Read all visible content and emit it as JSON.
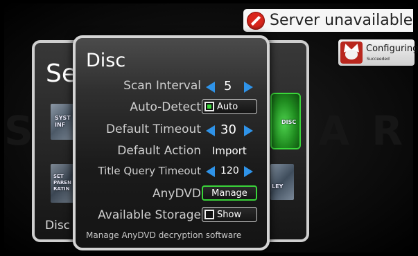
{
  "server_banner": {
    "text": "Server unavailable",
    "icon": "no-entry-icon",
    "color": "#d9261c"
  },
  "config_toast": {
    "title": "Configuring",
    "subtitle": "Succeeded",
    "icon": "fox-logo-icon"
  },
  "background": {
    "watermark": "S T E M   S E A R C H"
  },
  "left_card": {
    "title": "Se",
    "tiles": [
      {
        "text": "SYST INF"
      },
      {
        "text": "SET PAREN RATIN"
      }
    ],
    "footer": "Disc"
  },
  "right_card": {
    "tiles": [
      {
        "text": "DISC",
        "selected": true
      },
      {
        "text": "LEY"
      }
    ]
  },
  "panel": {
    "title": "Disc",
    "settings": [
      {
        "label": "Scan Interval",
        "value": "5",
        "control": "stepper"
      },
      {
        "label": "Auto-Detect",
        "value": "Auto",
        "control": "checkbox",
        "checked": true
      },
      {
        "label": "Default Timeout",
        "value": "30",
        "control": "stepper"
      },
      {
        "label": "Default Action",
        "value": "Import",
        "control": "text"
      },
      {
        "label": "Title Query Timeout",
        "value": "120",
        "control": "stepper"
      },
      {
        "label": "AnyDVD",
        "value": "Manage",
        "control": "button",
        "focused": true
      },
      {
        "label": "Available Storage",
        "value": "Show",
        "control": "checkbox",
        "checked": false
      }
    ],
    "footer": "Manage AnyDVD decryption software"
  },
  "colors": {
    "accent_blue": "#2f93e8",
    "focus_green": "#3ad53a",
    "frame": "#d4d4d4"
  }
}
